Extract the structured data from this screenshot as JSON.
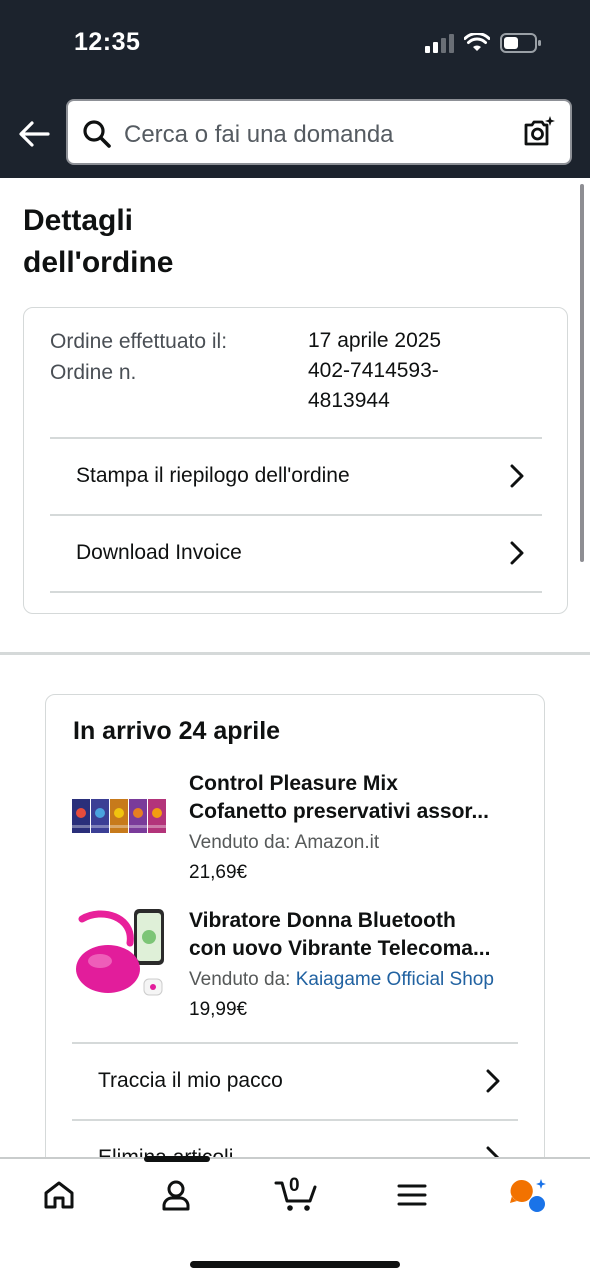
{
  "status_bar": {
    "time": "12:35"
  },
  "search": {
    "placeholder": "Cerca o fai una domanda"
  },
  "page": {
    "title_line1": "Dettagli",
    "title_line2": "dell'ordine"
  },
  "order_summary": {
    "date_label": "Ordine effettuato il:",
    "date_value": "17 aprile 2025",
    "number_label": "Ordine n.",
    "number_value_line1": "402-7414593-",
    "number_value_line2": "4813944",
    "links": [
      {
        "label": "Stampa il riepilogo dell'ordine"
      },
      {
        "label": "Download Invoice"
      }
    ]
  },
  "delivery": {
    "title": "In arrivo 24 aprile",
    "products": [
      {
        "name_line1": "Control Pleasure Mix",
        "name_line2": "Cofanetto preservativi assor...",
        "seller_label": "Venduto da: ",
        "seller_name": "Amazon.it",
        "price": "21,69€"
      },
      {
        "name_line1": "Vibratore Donna Bluetooth",
        "name_line2": "con uovo Vibrante Telecoma...",
        "seller_label": "Venduto da: ",
        "seller_name": "Kaiagame Official Shop",
        "price": "19,99€"
      }
    ],
    "actions": [
      {
        "label": "Traccia il mio pacco"
      },
      {
        "label": "Elimina articoli"
      }
    ]
  },
  "bottom_nav": {
    "cart_count": "0",
    "items": [
      "home-icon",
      "account-icon",
      "cart-icon",
      "menu-icon",
      "rufus-icon"
    ]
  },
  "colors": {
    "header_bg": "#1c232d",
    "link_blue": "#2162a1",
    "rufus_orange": "#f27200",
    "rufus_blue": "#1a73e8"
  }
}
